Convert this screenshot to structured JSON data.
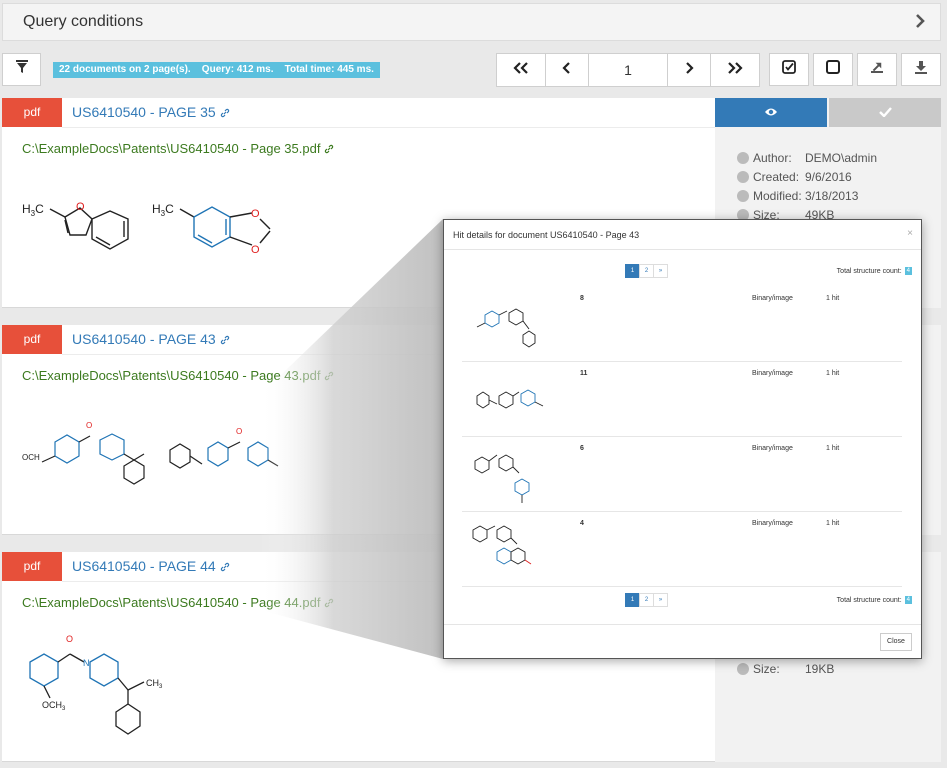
{
  "query": {
    "title": "Query conditions"
  },
  "status": {
    "text": "22 documents on 2 page(s).    Query: 412 ms.    Total time: 445 ms."
  },
  "pager": {
    "page": "1"
  },
  "cards": [
    {
      "badge": "pdf",
      "title": "US6410540 - PAGE 35",
      "path": "C:\\ExampleDocs\\Patents\\US6410540 - Page 35.pdf",
      "meta": {
        "author_label": "Author:",
        "author": "DEMO\\admin",
        "created_label": "Created:",
        "created": "9/6/2016",
        "modified_label": "Modified:",
        "modified": "3/18/2013",
        "size_label": "Size:",
        "size": "49KB"
      }
    },
    {
      "badge": "pdf",
      "title": "US6410540 - PAGE 43",
      "path": "C:\\ExampleDocs\\Patents\\US6410540 - Page 43.pdf"
    },
    {
      "badge": "pdf",
      "title": "US6410540 - PAGE 44",
      "path": "C:\\ExampleDocs\\Patents\\US6410540 - Page 44.pdf",
      "meta": {
        "size_label": "Size:",
        "size": "19KB"
      }
    }
  ],
  "chem_labels": {
    "h3c": "H",
    "sub3": "3",
    "c": "C",
    "o": "O",
    "ch3": "CH",
    "och3": "OCH",
    "n": "N"
  },
  "modal": {
    "title": "Hit details for document US6410540 - Page 43",
    "close_x": "×",
    "pages": [
      "1",
      "2",
      "»"
    ],
    "total_label": "Total structure count:",
    "total": "4",
    "rows": [
      {
        "num": "8",
        "type": "Binary/image",
        "hits": "1 hit"
      },
      {
        "num": "11",
        "type": "Binary/image",
        "hits": "1 hit"
      },
      {
        "num": "6",
        "type": "Binary/image",
        "hits": "1 hit"
      },
      {
        "num": "4",
        "type": "Binary/image",
        "hits": "1 hit"
      }
    ],
    "close": "Close"
  },
  "colors": {
    "pdf_badge": "#e7503a",
    "link": "#337ab7",
    "path": "#3c7a1f",
    "status": "#5bc0de",
    "primary": "#337ab7"
  }
}
